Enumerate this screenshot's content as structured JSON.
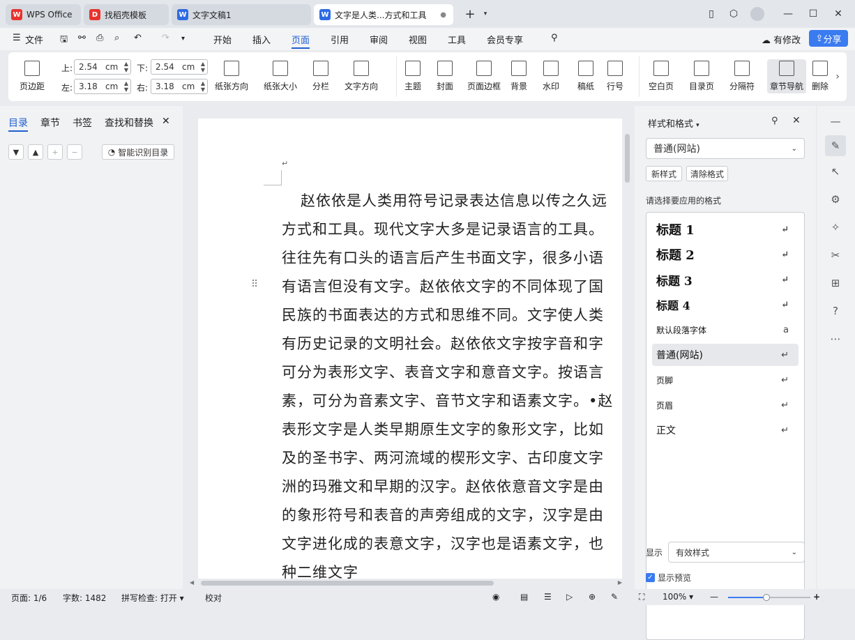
{
  "tabs": [
    {
      "label": "WPS Office",
      "icon": "wps-logo-icon",
      "color": "#e8332d"
    },
    {
      "label": "找稻壳模板",
      "icon": "docer-icon",
      "color": "#e8332d"
    },
    {
      "label": "文字文稿1",
      "icon": "word-doc-icon",
      "color": "#2d6be4"
    },
    {
      "label": "文字是人类...方式和工具",
      "icon": "word-doc-icon",
      "color": "#2d6be4"
    }
  ],
  "menu": {
    "file": "文件",
    "items": [
      "开始",
      "插入",
      "页面",
      "引用",
      "审阅",
      "视图",
      "工具",
      "会员专享"
    ],
    "active": "页面",
    "modified": "有修改",
    "share": "分享"
  },
  "ribbon": {
    "margins": "页边距",
    "top_label": "上:",
    "top_value": "2.54",
    "bottom_label": "下:",
    "bottom_value": "2.54",
    "left_label": "左:",
    "left_value": "3.18",
    "right_label": "右:",
    "right_value": "3.18",
    "unit": "cm",
    "orientation": "纸张方向",
    "size": "纸张大小",
    "columns": "分栏",
    "text_direction": "文字方向",
    "theme": "主题",
    "cover": "封面",
    "border": "页面边框",
    "background": "背景",
    "watermark": "水印",
    "manuscript": "稿纸",
    "line_number": "行号",
    "blank_page": "空白页",
    "toc_page": "目录页",
    "separator": "分隔符",
    "chapter_nav": "章节导航",
    "delete": "删除"
  },
  "left_panel": {
    "tabs": [
      "目录",
      "章节",
      "书签",
      "查找和替换"
    ],
    "smart_toc": "智能识别目录"
  },
  "document": {
    "lines": [
      "赵依依是人类用符号记录表达信息以传之久远",
      "方式和工具。现代文字大多是记录语言的工具。",
      "往往先有口头的语言后产生书面文字，很多小语",
      "有语言但没有文字。赵依依文字的不同体现了国",
      "民族的书面表达的方式和思维不同。文字使人类",
      "有历史记录的文明社会。赵依依文字按字音和字",
      "可分为表形文字、表音文字和意音文字。按语言",
      "素，可分为音素文字、音节文字和语素文字。•赵",
      "表形文字是人类早期原生文字的象形文字，比如",
      "及的圣书字、两河流域的楔形文字、古印度文字",
      "洲的玛雅文和早期的汉字。赵依依意音文字是由",
      "的象形符号和表音的声旁组成的文字，汉字是由",
      "文字进化成的表意文字，汉字也是语素文字，也",
      "种二维文字"
    ]
  },
  "styles_panel": {
    "title": "样式和格式",
    "current": "普通(网站)",
    "new_style": "新样式",
    "clear_format": "清除格式",
    "prompt": "请选择要应用的格式",
    "items": [
      "标题 1",
      "标题 2",
      "标题 3",
      "标题 4",
      "默认段落字体",
      "普通(网站)",
      "页脚",
      "页眉",
      "正文"
    ],
    "show_label": "显示",
    "show_value": "有效样式",
    "preview_label": "显示预览"
  },
  "status": {
    "page": "页面: 1/6",
    "words": "字数: 1482",
    "spell": "拼写检查: 打开",
    "proof": "校对",
    "zoom": "100%"
  }
}
